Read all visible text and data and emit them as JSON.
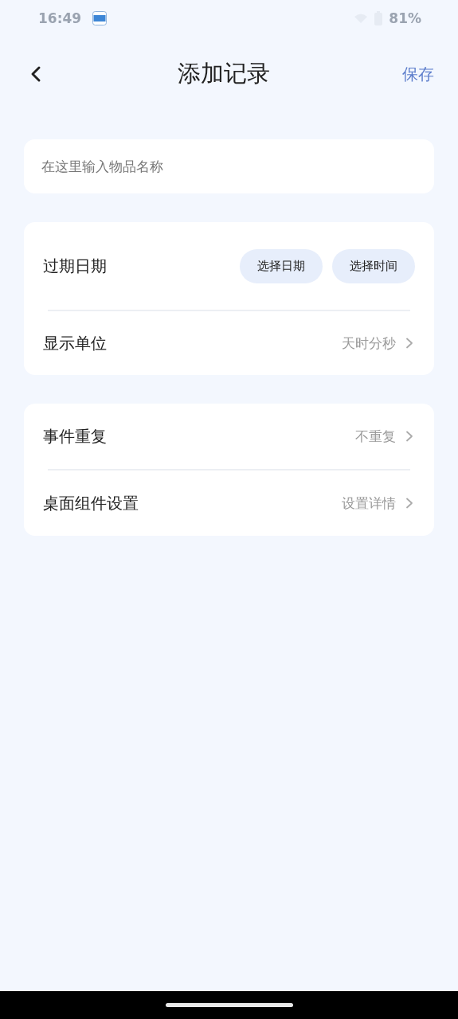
{
  "status_bar": {
    "time": "16:49",
    "battery": "81%"
  },
  "header": {
    "title": "添加记录",
    "action": "保存"
  },
  "name_field": {
    "placeholder": "在这里输入物品名称"
  },
  "groups": [
    {
      "rows": [
        {
          "kind": "buttons",
          "label": "过期日期",
          "buttons": [
            "选择日期",
            "选择时间"
          ]
        },
        {
          "kind": "link",
          "label": "显示单位",
          "value": "天时分秒"
        }
      ]
    },
    {
      "rows": [
        {
          "kind": "link",
          "label": "事件重复",
          "value": "不重复"
        },
        {
          "kind": "link",
          "label": "桌面组件设置",
          "value": "设置详情"
        }
      ]
    }
  ]
}
